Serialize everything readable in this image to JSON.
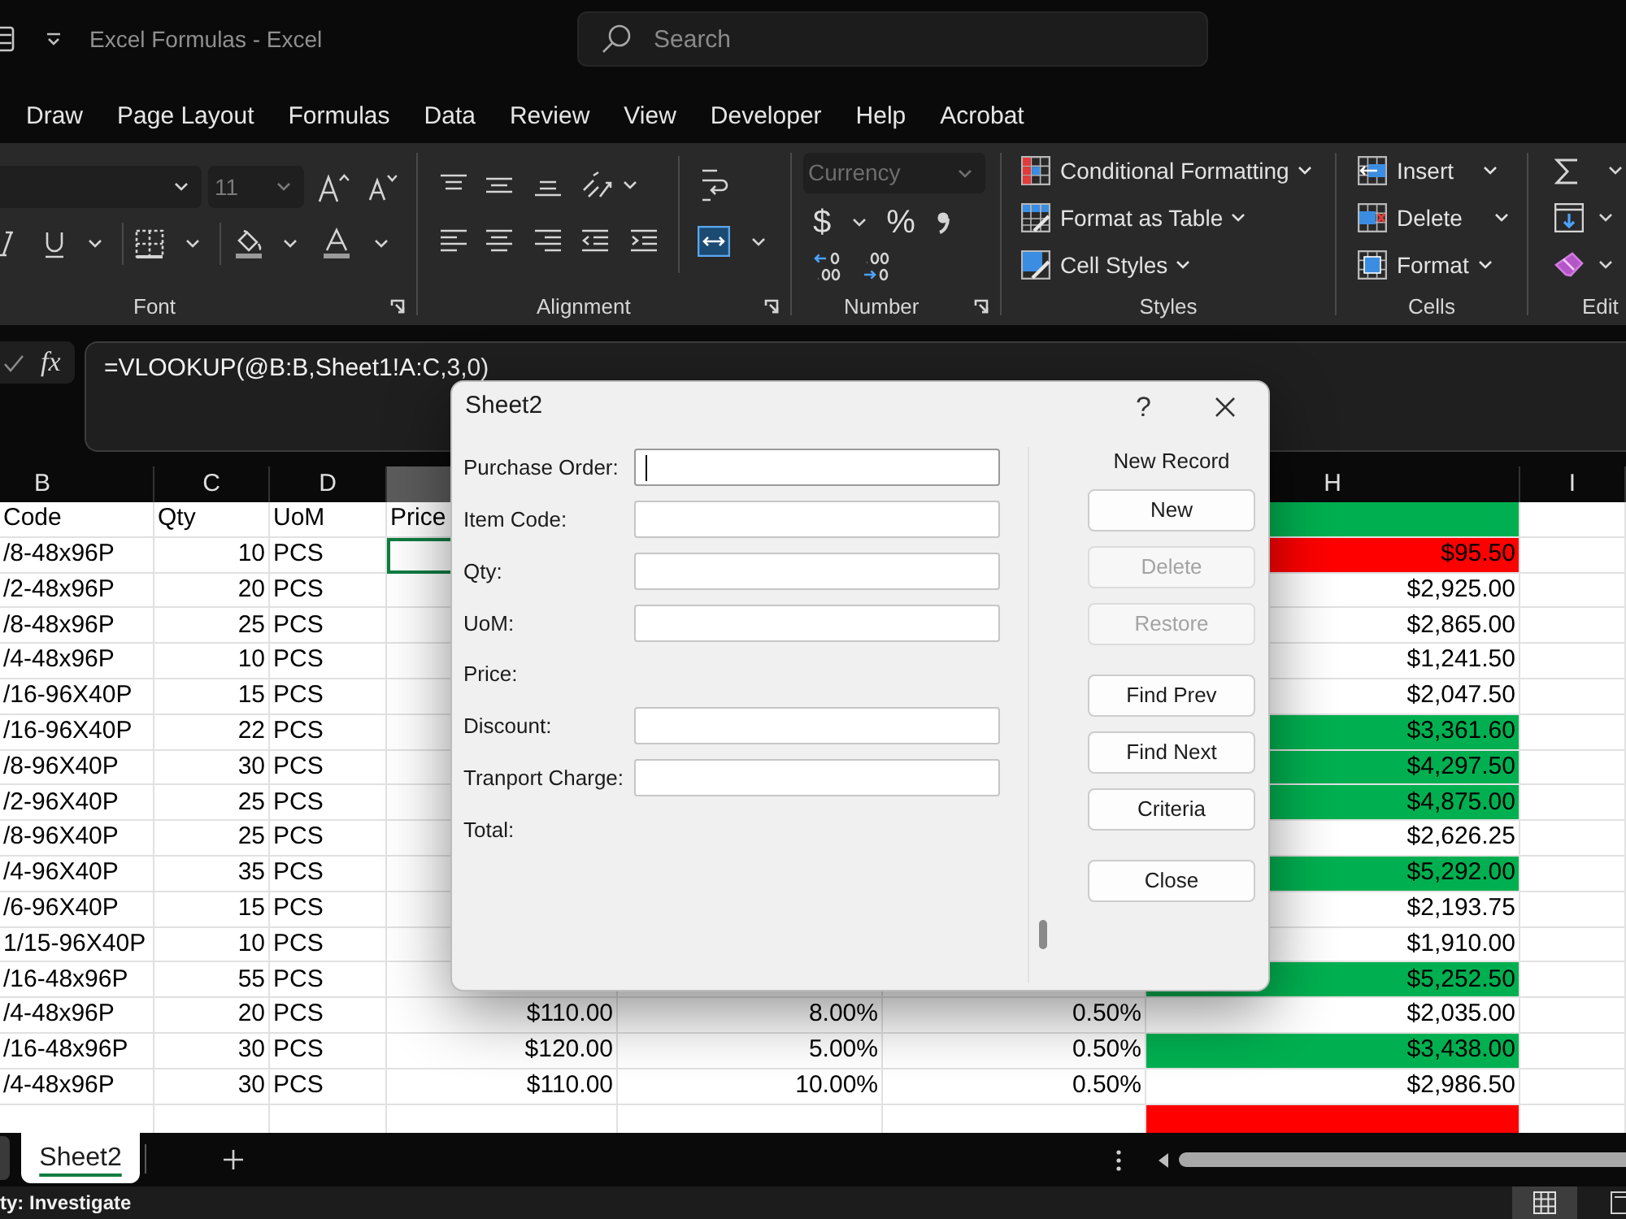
{
  "title_bar": {
    "title": "Excel Formulas - Excel",
    "search": {
      "placeholder": "Search"
    }
  },
  "menu_tabs": [
    {
      "label": "Draw",
      "selected": false
    },
    {
      "label": "Page Layout",
      "selected": false
    },
    {
      "label": "Formulas",
      "selected": false
    },
    {
      "label": "Data",
      "selected": false
    },
    {
      "label": "Review",
      "selected": false
    },
    {
      "label": "View",
      "selected": false
    },
    {
      "label": "Developer",
      "selected": false
    },
    {
      "label": "Help",
      "selected": false
    },
    {
      "label": "Acrobat",
      "selected": false
    }
  ],
  "ribbon": {
    "font": {
      "label": "Font",
      "size": {
        "value": "11",
        "disabled": true
      }
    },
    "alignment": {
      "label": "Alignment"
    },
    "number": {
      "label": "Number",
      "format": {
        "value": "Currency",
        "disabled": true
      },
      "accounting": "$",
      "percent": "%"
    },
    "styles": {
      "label": "Styles",
      "buttons": [
        "Conditional Formatting",
        "Format as Table",
        "Cell Styles"
      ]
    },
    "cells": {
      "label": "Cells",
      "buttons": [
        "Insert",
        "Delete",
        "Format"
      ]
    },
    "editing": {
      "label": "Edit"
    }
  },
  "formula_bar": {
    "function_button": "fx",
    "formula": "=VLOOKUP(@B:B,Sheet1!A:C,3,0)"
  },
  "sheet": {
    "column_headers": {
      "B": {
        "label": "B",
        "selected": false
      },
      "C": {
        "label": "C",
        "selected": false
      },
      "D": {
        "label": "D",
        "selected": false
      },
      "E": {
        "selected": true
      },
      "H": {
        "label": "H",
        "selected": false
      },
      "I": {
        "label": "I",
        "selected": false
      }
    },
    "rows": [
      {
        "kind": "header",
        "B": "Code",
        "C": "Qty",
        "D": "UoM",
        "E": {
          "text": "Price",
          "active": false
        },
        "H": {
          "color": "#00b050"
        }
      },
      {
        "kind": "record",
        "B": "/8-48x96P",
        "C": "10",
        "D": "PCS",
        "E": {
          "active": true
        },
        "H": {
          "text": "$95.50",
          "color": "#ff0000"
        }
      },
      {
        "kind": "record",
        "B": "/2-48x96P",
        "C": "20",
        "D": "PCS",
        "E": {
          "active": false
        },
        "H": {
          "text": "$2,925.00",
          "color": "#ffffff"
        }
      },
      {
        "kind": "record",
        "B": "/8-48x96P",
        "C": "25",
        "D": "PCS",
        "E": {
          "active": false
        },
        "H": {
          "text": "$2,865.00",
          "color": "#ffffff"
        }
      },
      {
        "kind": "record",
        "B": "/4-48x96P",
        "C": "10",
        "D": "PCS",
        "E": {
          "active": false
        },
        "H": {
          "text": "$1,241.50",
          "color": "#ffffff"
        }
      },
      {
        "kind": "record",
        "B": "/16-96X40P",
        "C": "15",
        "D": "PCS",
        "E": {
          "active": false
        },
        "H": {
          "text": "$2,047.50",
          "color": "#ffffff"
        }
      },
      {
        "kind": "record",
        "B": "/16-96X40P",
        "C": "22",
        "D": "PCS",
        "E": {
          "active": false
        },
        "H": {
          "text": "$3,361.60",
          "color": "#00b050"
        }
      },
      {
        "kind": "record",
        "B": "/8-96X40P",
        "C": "30",
        "D": "PCS",
        "E": {
          "active": false
        },
        "H": {
          "text": "$4,297.50",
          "color": "#00b050"
        }
      },
      {
        "kind": "record",
        "B": "/2-96X40P",
        "C": "25",
        "D": "PCS",
        "E": {
          "active": false
        },
        "H": {
          "text": "$4,875.00",
          "color": "#00b050"
        }
      },
      {
        "kind": "record",
        "B": "/8-96X40P",
        "C": "25",
        "D": "PCS",
        "E": {
          "active": false
        },
        "H": {
          "text": "$2,626.25",
          "color": "#ffffff"
        }
      },
      {
        "kind": "record",
        "B": "/4-96X40P",
        "C": "35",
        "D": "PCS",
        "E": {
          "active": false
        },
        "H": {
          "text": "$5,292.00",
          "color": "#00b050"
        }
      },
      {
        "kind": "record",
        "B": "/6-96X40P",
        "C": "15",
        "D": "PCS",
        "E": {
          "active": false
        },
        "H": {
          "text": "$2,193.75",
          "color": "#ffffff"
        }
      },
      {
        "kind": "record",
        "B": "1/15-96X40P",
        "C": "10",
        "D": "PCS",
        "E": {
          "active": false
        },
        "H": {
          "text": "$1,910.00",
          "color": "#ffffff"
        }
      },
      {
        "kind": "record",
        "B": "/16-48x96P",
        "C": "55",
        "D": "PCS",
        "E": {
          "active": false
        },
        "H": {
          "text": "$5,252.50",
          "color": "#00b050"
        }
      },
      {
        "kind": "record",
        "B": "/4-48x96P",
        "C": "20",
        "D": "PCS",
        "E": {
          "text": "$110.00",
          "active": false
        },
        "F": "8.00%",
        "G": "0.50%",
        "H": {
          "text": "$2,035.00",
          "color": "#ffffff"
        }
      },
      {
        "kind": "record",
        "B": "/16-48x96P",
        "C": "30",
        "D": "PCS",
        "E": {
          "text": "$120.00",
          "active": false
        },
        "F": "5.00%",
        "G": "0.50%",
        "H": {
          "text": "$3,438.00",
          "color": "#00b050"
        }
      },
      {
        "kind": "record",
        "B": "/4-48x96P",
        "C": "30",
        "D": "PCS",
        "E": {
          "text": "$110.00",
          "active": false
        },
        "F": "10.00%",
        "G": "0.50%",
        "H": {
          "text": "$2,986.50",
          "color": "#ffffff"
        }
      },
      {
        "kind": "blank",
        "E": {
          "active": false
        },
        "H": {
          "color": "#ff0000"
        }
      }
    ]
  },
  "dialog": {
    "title": "Sheet2",
    "help": "?",
    "fields": [
      {
        "label": "Purchase Order:",
        "kind": "input",
        "focused": true
      },
      {
        "label": "Item Code:",
        "kind": "input",
        "focused": false
      },
      {
        "label": "Qty:",
        "kind": "input",
        "focused": false
      },
      {
        "label": "UoM:",
        "kind": "input",
        "focused": false
      },
      {
        "label": "Price:",
        "kind": "computed"
      },
      {
        "label": "Discount:",
        "kind": "input",
        "focused": false
      },
      {
        "label": "Tranport Charge:",
        "kind": "input",
        "focused": false
      },
      {
        "label": "Total:",
        "kind": "computed"
      }
    ],
    "record_status": "New Record",
    "button_groups": [
      [
        {
          "label": "New",
          "disabled": false
        },
        {
          "label": "Delete",
          "disabled": true
        },
        {
          "label": "Restore",
          "disabled": true
        }
      ],
      [
        {
          "label": "Find Prev",
          "disabled": false
        },
        {
          "label": "Find Next",
          "disabled": false
        },
        {
          "label": "Criteria",
          "disabled": false
        }
      ],
      [
        {
          "label": "Close",
          "disabled": false
        }
      ]
    ]
  },
  "sheet_tabs": [
    {
      "label": "Sheet2",
      "selected": true
    }
  ],
  "status_bar": {
    "text": "ty: Investigate"
  }
}
